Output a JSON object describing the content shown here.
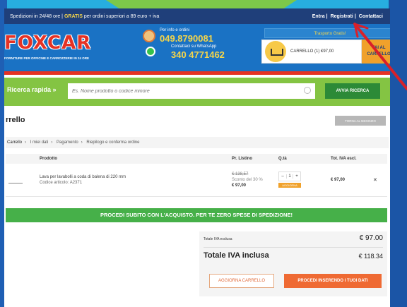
{
  "topbar": {
    "promo_text": "Spedizioni in 24/48 ore | ",
    "promo_highlight": "GRATIS",
    "promo_text2": " per ordini superiori a 89 euro + iva",
    "links": [
      "Entra",
      "Registrati",
      "Contattaci"
    ]
  },
  "header": {
    "logo": "FOXCAR",
    "logo_sub": "FORNITURE PER OFFICINE E CARROZZERIE IN 24 ORE",
    "info_label": "Per info e ordini",
    "phone": "049.8790081",
    "whatsapp_label": "Contattaci su WhatsApp",
    "whatsapp_phone": "340 4771462",
    "shipping_label": "Trasporto Gratis!",
    "cart_label": "CARRELLO (1) €97,00",
    "goto_cart": "VAI AL CARRELLO"
  },
  "search": {
    "label": "Ricerca rapida »",
    "placeholder": "Es. Nome prodotto o codice minore",
    "button": "AVVIA RICERCA"
  },
  "cart": {
    "title": "rrello",
    "back_button": "TORNA AL NEGOZIO",
    "breadcrumb": [
      "Carrello",
      "I miei dati",
      "Pagamento",
      "Riepilogo e conferma ordine"
    ],
    "columns": [
      "Prodotto",
      "Pr. Listino",
      "Q.tà",
      "Tot. IVA escl."
    ],
    "items": [
      {
        "name": "Lava per lavabolli a coda di balena di 220 mm",
        "code": "Codice articolo: A2371",
        "price_old": "€ 138,57",
        "discount": "Sconto del 30 %",
        "price_new": "€ 97,00",
        "qty": "1",
        "update_label": "AGGIORNA",
        "total": "€ 97,00",
        "delete_label": "✕"
      }
    ],
    "banner": "PROCEDI SUBITO CON L'ACQUISTO. PER TE ZERO SPESE DI SPEDIZIONE!",
    "subtotal_label": "Totale IVA esclusa",
    "subtotal_value": "€ 97.00",
    "total_label": "Totale IVA inclusa",
    "total_value": "€ 118.34",
    "update_cart_button": "AGGIORNA CARRELLO",
    "checkout_button": "PROCEDI INSERENDO I TUOI DATI"
  },
  "colors": {
    "brand_blue": "#1a72c4",
    "brand_red": "#e53225",
    "search_green": "#84c443",
    "banner_green": "#46b049",
    "checkout_orange": "#ef6a33"
  }
}
